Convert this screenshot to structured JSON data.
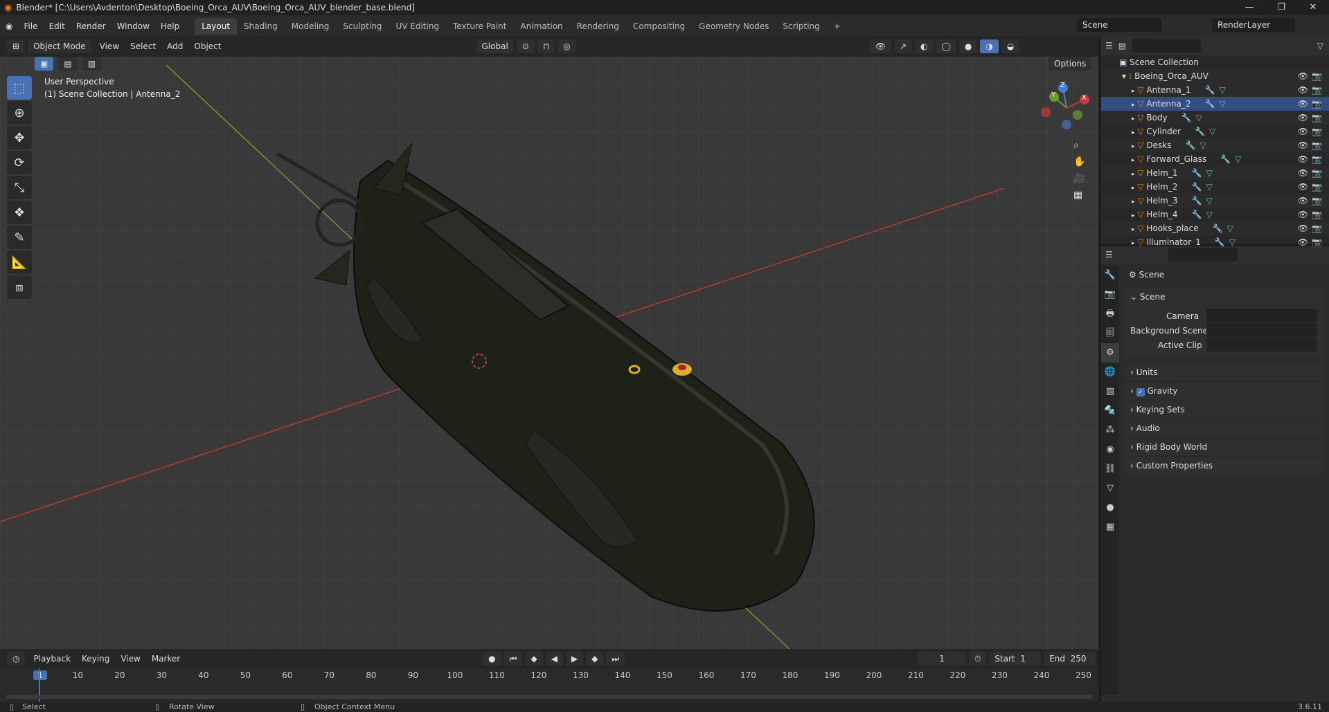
{
  "window": {
    "title": "Blender* [C:\\Users\\Avdenton\\Desktop\\Boeing_Orca_AUV\\Boeing_Orca_AUV_blender_base.blend]",
    "minimize": "—",
    "maximize": "❐",
    "close": "✕"
  },
  "menus": [
    "File",
    "Edit",
    "Render",
    "Window",
    "Help"
  ],
  "workspaces": [
    "Layout",
    "Shading",
    "Modeling",
    "Sculpting",
    "UV Editing",
    "Texture Paint",
    "Animation",
    "Rendering",
    "Compositing",
    "Geometry Nodes",
    "Scripting"
  ],
  "active_workspace": "Layout",
  "add_workspace": "+",
  "scene_selector": "Scene",
  "render_layer": "RenderLayer",
  "viewport_header": {
    "mode": "Object Mode",
    "menus": [
      "View",
      "Select",
      "Add",
      "Object"
    ],
    "transform": "Global",
    "options": "Options"
  },
  "viewport_info": {
    "line1": "User Perspective",
    "line2": "(1) Scene Collection | Antenna_2"
  },
  "gizmo": {
    "x": "X",
    "y": "Y",
    "z": "Z"
  },
  "outliner": {
    "root": "Scene Collection",
    "collection": "Boeing_Orca_AUV",
    "items": [
      "Antenna_1",
      "Antenna_2",
      "Body",
      "Cylinder",
      "Desks",
      "Forward_Glass",
      "Helm_1",
      "Helm_2",
      "Helm_3",
      "Helm_4",
      "Hooks_place",
      "Illuminator_1"
    ],
    "selected": "Antenna_2"
  },
  "properties": {
    "context": "Scene",
    "scene_panel": "Scene",
    "camera_label": "Camera",
    "bg_scene_label": "Background Scene",
    "clip_label": "Active Clip",
    "panels": [
      "Units",
      "Gravity",
      "Keying Sets",
      "Audio",
      "Rigid Body World",
      "Custom Properties"
    ],
    "gravity_checked": true
  },
  "timeline": {
    "menus": [
      "Playback",
      "Keying",
      "View",
      "Marker"
    ],
    "current_frame": "1",
    "start_label": "Start",
    "start": "1",
    "end_label": "End",
    "end": "250",
    "ticks": [
      "1",
      "10",
      "20",
      "30",
      "40",
      "50",
      "60",
      "70",
      "80",
      "90",
      "100",
      "110",
      "120",
      "130",
      "140",
      "150",
      "160",
      "170",
      "180",
      "190",
      "200",
      "210",
      "220",
      "230",
      "240",
      "250"
    ]
  },
  "status": {
    "select": "Select",
    "rotate": "Rotate View",
    "context": "Object Context Menu",
    "version": "3.6.11"
  },
  "colors": {
    "accent": "#4772b3",
    "orange": "#e87d0d",
    "x_axis": "#b73a3a",
    "y_axis": "#6a9b2f"
  }
}
